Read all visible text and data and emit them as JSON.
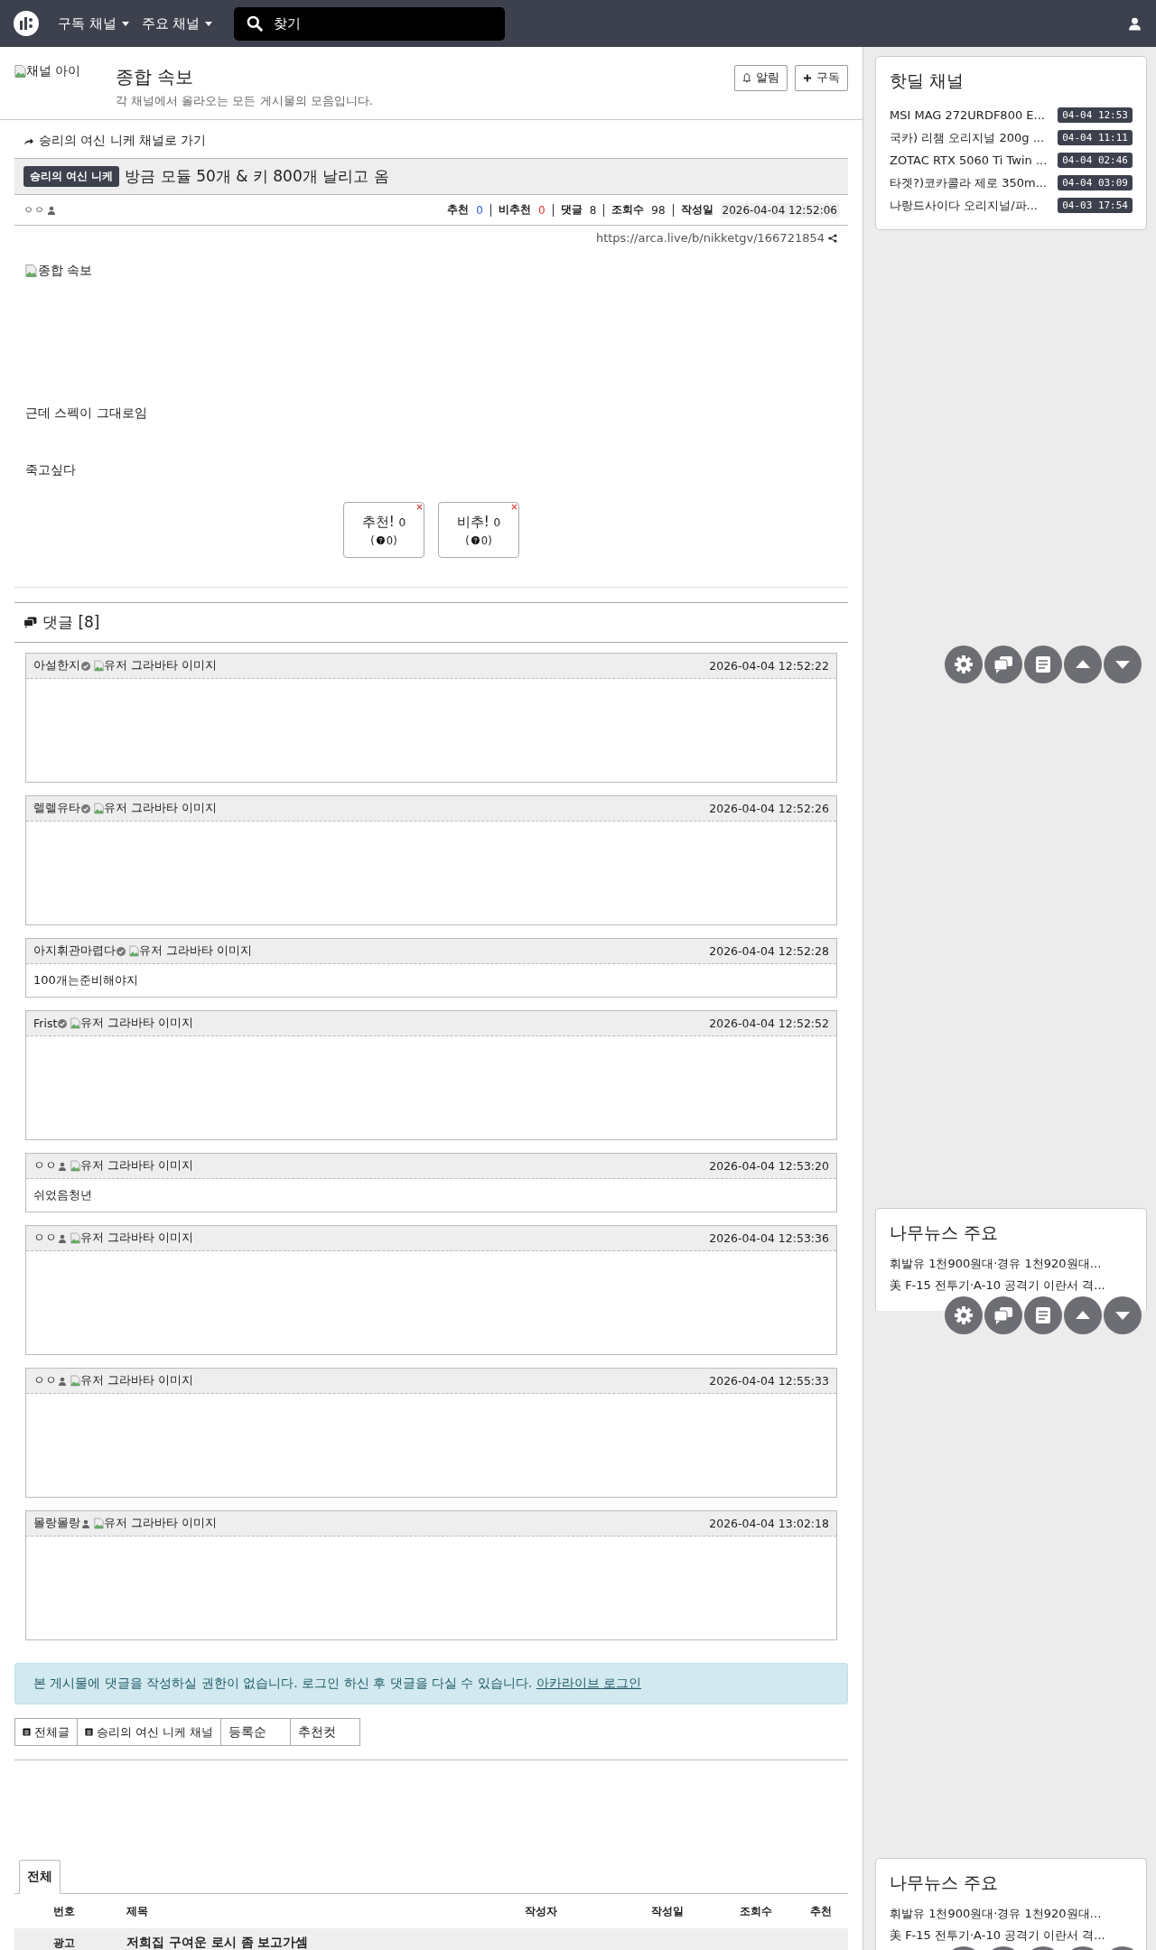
{
  "nav": {
    "menus": [
      {
        "label": "구독 채널"
      },
      {
        "label": "주요 채널"
      }
    ],
    "search": {
      "placeholder": "찾기"
    }
  },
  "channel": {
    "icon_alt": "채널 아이",
    "title": "종합 속보",
    "description": "각 채널에서 올라오는 모든 게시물의 모음입니다.",
    "buttons": [
      {
        "label": "알림",
        "kind": "bell"
      },
      {
        "label": "구독",
        "kind": "plus"
      }
    ]
  },
  "post": {
    "back_link": "승리의 여신 니케 채널로 가기",
    "category": "승리의 여신 니케",
    "title": "방금 모듈 50개 & 키 800개 날리고 옴",
    "author": "ㅇㅇ",
    "stats": [
      {
        "label": "추천",
        "value": "0",
        "kind": "up"
      },
      {
        "label": "비추천",
        "value": "0",
        "kind": "down"
      },
      {
        "label": "댓글",
        "value": "8",
        "kind": "plain"
      },
      {
        "label": "조회수",
        "value": "98",
        "kind": "plain"
      },
      {
        "label": "작성일",
        "value": "2026-04-04 12:52:06",
        "kind": "date"
      }
    ],
    "url": "https://arca.live/b/nikketgv/166721854",
    "image_alt": "종합 속보",
    "paragraphs": [
      "근데 스펙이 그대로임",
      "죽고싶다"
    ],
    "votes": [
      {
        "label": "추천!",
        "count": "0",
        "open": "(",
        "sub": "0)"
      },
      {
        "label": "비추!",
        "count": "0",
        "open": "(",
        "sub": "0)"
      }
    ]
  },
  "comments": {
    "title": "댓글 [8]",
    "items": [
      {
        "author": "아설한지",
        "kind": "verified",
        "avatar_alt": "유저 그라바타 이미지",
        "time": "2026-04-04 12:52:22"
      },
      {
        "author": "렐렐유타",
        "kind": "verified",
        "avatar_alt": "유저 그라바타 이미지",
        "time": "2026-04-04 12:52:26"
      },
      {
        "author": "아지휘관마렵다",
        "kind": "verified",
        "avatar_alt": "유저 그라바타 이미지",
        "time": "2026-04-04 12:52:28",
        "text": "100개는준비해야지"
      },
      {
        "author": "Frist",
        "kind": "verified",
        "avatar_alt": "유저 그라바타 이미지",
        "time": "2026-04-04 12:52:52"
      },
      {
        "author": "ㅇㅇ",
        "kind": "user",
        "avatar_alt": "유저 그라바타 이미지",
        "time": "2026-04-04 12:53:20",
        "text": "쉬었음청년"
      },
      {
        "author": "ㅇㅇ",
        "kind": "user",
        "avatar_alt": "유저 그라바타 이미지",
        "time": "2026-04-04 12:53:36"
      },
      {
        "author": "ㅇㅇ",
        "kind": "user",
        "avatar_alt": "유저 그라바타 이미지",
        "time": "2026-04-04 12:55:33"
      },
      {
        "author": "몰랑몰랑",
        "kind": "user",
        "avatar_alt": "유저 그라바타 이미지",
        "time": "2026-04-04 13:02:18"
      }
    ]
  },
  "login_notice": {
    "text": "본 게시물에 댓글을 작성하실 권한이 없습니다. 로그인 하신 후 댓글을 다실 수 있습니다.",
    "link": "아카라이브 로그인"
  },
  "list_tabs": [
    {
      "label": "전체글",
      "kind": "board"
    },
    {
      "label": "승리의 여신 니케 채널",
      "kind": "board"
    },
    {
      "label": "등록순",
      "kind": "plain"
    },
    {
      "label": "추천컷",
      "kind": "plain"
    }
  ],
  "board": {
    "tabs": [
      {
        "label": "전체",
        "selected": true
      }
    ],
    "columns": [
      "번호",
      "제목",
      "작성자",
      "작성일",
      "조회수",
      "추천"
    ],
    "rows": [
      {
        "number": "광고",
        "title": "저희집 구여운 로시 좀 보고가셈"
      }
    ]
  },
  "sidebar": {
    "hot_deal": {
      "title": "핫딜 채널",
      "items": [
        {
          "title": "MSI MAG 272URDF800 E...",
          "time": "04-04 12:53"
        },
        {
          "title": "국카) 리챔 오리지널 200g ...",
          "time": "04-04 11:11"
        },
        {
          "title": "ZOTAC RTX 5060 Ti Twin ...",
          "time": "04-04 02:46"
        },
        {
          "title": "타겟?)코카콜라 제로 350m...",
          "time": "04-04 03:09"
        },
        {
          "title": "나랑드사이다 오리지널/파...",
          "time": "04-03 17:54"
        }
      ]
    },
    "news": [
      {
        "title": "나무뉴스 주요",
        "items": [
          "휘발유 1천900원대·경유 1천920원대…",
          "美 F-15 전투기·A-10 공격기 이란서 격..."
        ]
      },
      {
        "title": "나무뉴스 주요",
        "items": [
          "휘발유 1천900원대·경유 1천920원대…",
          "美 F-15 전투기·A-10 공격기 이란서 격..."
        ]
      }
    ]
  }
}
